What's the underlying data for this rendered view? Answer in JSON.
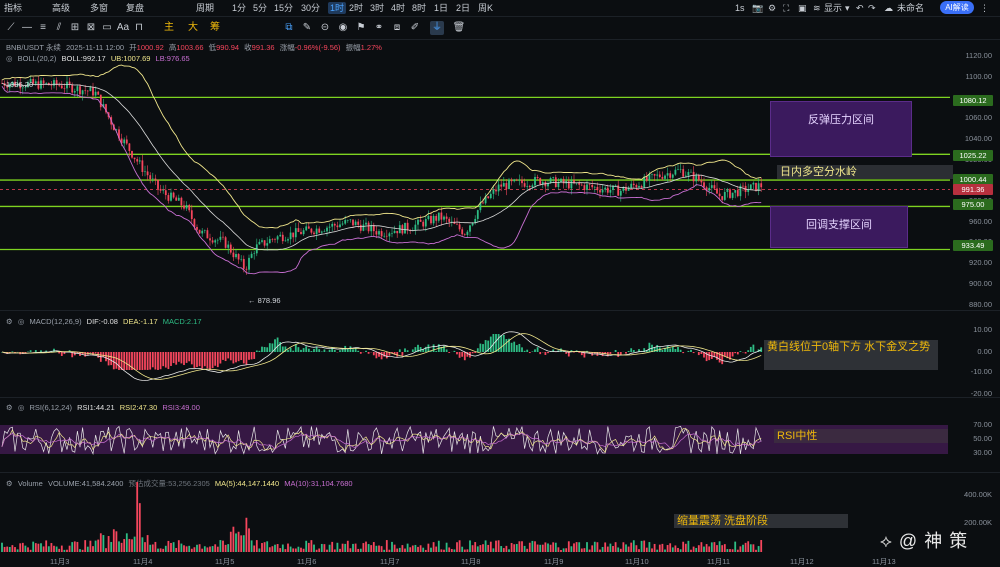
{
  "topbar": {
    "items": [
      "指标",
      "高级",
      "多窗",
      "复盘",
      "周期",
      "1分",
      "5分",
      "15分",
      "30分",
      "1时",
      "2时",
      "3时",
      "4时",
      "8时",
      "1日",
      "2日",
      "周K"
    ],
    "active": "1时",
    "right": [
      "1s",
      "显示",
      "未命名",
      "AI解读"
    ]
  },
  "drawing_tools": {
    "items": [
      "主",
      "大",
      "筹"
    ]
  },
  "price_legend": {
    "symbol": "BNB/USDT 永续",
    "datetime": "2025-11-11 12:00",
    "open_label": "开",
    "open": "1000.92",
    "high_label": "高",
    "high": "1003.66",
    "low_label": "低",
    "low": "990.94",
    "close_label": "收",
    "close": "991.36",
    "change_label": "涨幅",
    "change": "-0.96%(-9.56)",
    "amp_label": "振幅",
    "amp": "1.27%"
  },
  "boll_legend": {
    "name": "BOLL(20,2)",
    "mid": "BOLL:992.17",
    "ub": "UB:1007.69",
    "lb": "LB:976.65"
  },
  "price_axis": [
    "1120.00",
    "1100.00",
    "1080.00",
    "1060.00",
    "1040.00",
    "1020.00",
    "1000.00",
    "980.00",
    "960.00",
    "940.00",
    "920.00",
    "900.00",
    "880.00"
  ],
  "level_tags": [
    {
      "label": "1080.12",
      "color": "#2b6b1e"
    },
    {
      "label": "1025.22",
      "color": "#2b6b1e"
    },
    {
      "label": "1000.44",
      "color": "#2b6b1e"
    },
    {
      "label": "991.36",
      "color": "#b7303e"
    },
    {
      "label": "975.00",
      "color": "#2b6b1e"
    },
    {
      "label": "933.49",
      "color": "#2b6b1e"
    }
  ],
  "annotations": {
    "high_price": "1096.20",
    "low_price": "878.96",
    "resistance_zone": "反弹压力区间",
    "pivot": "日内多空分水岭",
    "support_zone": "回调支撑区间",
    "macd_note": "黄白线位于0轴下方 水下金叉之势",
    "rsi_note": "RSI中性",
    "vol_note": "缩量震荡 洗盘阶段"
  },
  "macd_legend": {
    "name": "MACD(12,26,9)",
    "dif": "DIF:-0.08",
    "dea": "DEA:-1.17",
    "macd": "MACD:2.17"
  },
  "macd_axis": [
    "10.00",
    "0.00",
    "-10.00",
    "-20.00"
  ],
  "rsi_legend": {
    "name": "RSI(6,12,24)",
    "rsi1": "RSI1:44.21",
    "rsi2": "RSI2:47.30",
    "rsi3": "RSI3:49.00"
  },
  "rsi_axis": [
    "70.00",
    "50.00",
    "30.00"
  ],
  "vol_legend": {
    "name": "Volume",
    "volume": "VOLUME:41,584.2400",
    "est": "预估成交量:53,256.2305",
    "ma5": "MA(5):44,147.1440",
    "ma10": "MA(10):31,104.7680"
  },
  "vol_axis": [
    "400.00K",
    "200.00K"
  ],
  "x_axis": [
    "11月3",
    "11月4",
    "11月5",
    "11月6",
    "11月7",
    "11月8",
    "11月9",
    "11月10",
    "11月11",
    "11月12",
    "11月13"
  ],
  "watermark": "@ 神 策",
  "colors": {
    "up": "#2ebd85",
    "down": "#f6465d",
    "level": "#7ed321",
    "boll_upper": "#f0e68c",
    "boll_mid": "#d9d9d9",
    "boll_lower": "#c86fd2",
    "accent": "#f0b90b"
  }
}
